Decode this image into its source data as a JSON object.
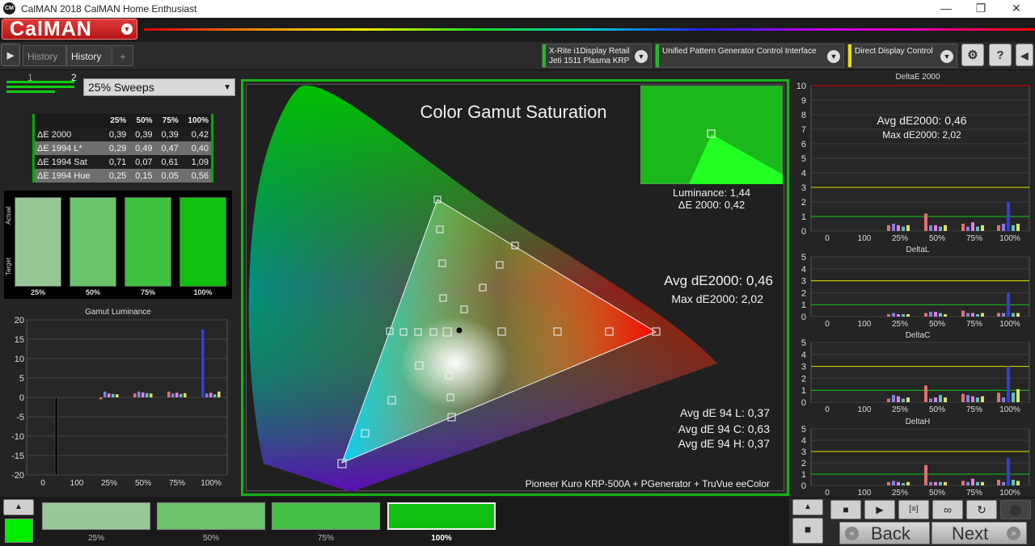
{
  "window": {
    "title": "CalMAN 2018 CalMAN Home Enthusiast",
    "icon_text": "CM",
    "controls": {
      "minimize": "—",
      "maximize": "❐",
      "close": "✕"
    }
  },
  "brand": {
    "logo_text": "CalMAN"
  },
  "tabs": {
    "play": "▶",
    "items": [
      {
        "label": "History 1"
      },
      {
        "label": "History 2"
      }
    ],
    "add": "+"
  },
  "devices": [
    {
      "line1": "X-Rite i1Display Retail",
      "line2": "Jeti 1511 Plasma KRP",
      "color": "#22bb22"
    },
    {
      "line1": "Unified Pattern Generator Control Interface",
      "line2": "",
      "color": "#22bb22"
    },
    {
      "line1": "Direct Display Control",
      "line2": "",
      "color": "#e8e000"
    }
  ],
  "toolbar_icons": {
    "settings": "⚙",
    "help": "?",
    "collapse": "◀"
  },
  "sweep_select": {
    "value": "25% Sweeps"
  },
  "summary_table": {
    "columns": [
      "",
      "25%",
      "50%",
      "75%",
      "100%"
    ],
    "rows": [
      {
        "label": "ΔE 2000",
        "values": [
          "0,39",
          "0,39",
          "0,39",
          "0,42"
        ]
      },
      {
        "label": "ΔE 1994 L*",
        "values": [
          "0,29",
          "0,49",
          "0,47",
          "0,40"
        ]
      },
      {
        "label": "ΔE 1994 Sat",
        "values": [
          "0,71",
          "0,07",
          "0,61",
          "1,09"
        ]
      },
      {
        "label": "ΔE 1994 Hue",
        "values": [
          "0,25",
          "0,15",
          "0,05",
          "0,56"
        ]
      }
    ]
  },
  "swatches": {
    "actual_label": "Actual",
    "target_label": "Target",
    "items": [
      {
        "label": "25%",
        "color": "#96c896"
      },
      {
        "label": "50%",
        "color": "#6ac46a"
      },
      {
        "label": "75%",
        "color": "#40c040"
      },
      {
        "label": "100%",
        "color": "#10c010"
      }
    ]
  },
  "gamut_luminance": {
    "title": "Gamut Luminance",
    "y_ticks": [
      "20",
      "15",
      "10",
      "5",
      "0",
      "-5",
      "-10",
      "-15",
      "-20"
    ],
    "x_ticks": [
      "0",
      "100",
      "25%",
      "50%",
      "75%",
      "100%"
    ],
    "ylim": [
      -20,
      20
    ],
    "black_bar": -20,
    "groups": [
      [
        -0.5,
        1.5,
        1.0,
        0.9,
        0.8
      ],
      [
        1.0,
        1.5,
        1.3,
        1.1,
        1.0
      ],
      [
        1.5,
        1.0,
        1.2,
        0.9,
        1.1
      ],
      [
        17.5,
        1.0,
        1.2,
        0.8,
        1.5
      ]
    ]
  },
  "gamut": {
    "title": "Color Gamut Saturation",
    "luminance": "Luminance: 1,44",
    "de2000_current": "ΔE 2000: 0,42",
    "avg": "Avg dE2000: 0,46",
    "max": "Max dE2000: 2,02",
    "avg_l": "Avg dE 94 L: 0,37",
    "avg_c": "Avg dE 94 C: 0,63",
    "avg_h": "Avg dE 94 H: 0,37",
    "footer": "Pioneer Kuro KRP-500A + PGenerator + TruVue eeColor"
  },
  "right_charts": [
    {
      "title": "DeltaE 2000",
      "ymax": 10,
      "y_ticks": [
        "10",
        "9",
        "8",
        "7",
        "6",
        "5",
        "4",
        "3",
        "2",
        "1",
        "0"
      ],
      "avg": "Avg dE2000: 0,46",
      "max": "Max dE2000: 2,02",
      "groups": [
        [
          0.4,
          0.5,
          0.4,
          0.3,
          0.4
        ],
        [
          1.2,
          0.4,
          0.4,
          0.3,
          0.4
        ],
        [
          0.5,
          0.3,
          0.6,
          0.3,
          0.4
        ],
        [
          0.4,
          0.5,
          2.0,
          0.4,
          0.5
        ]
      ]
    },
    {
      "title": "DeltaL",
      "ymax": 5,
      "y_ticks": [
        "5",
        "4",
        "3",
        "2",
        "1",
        "0"
      ],
      "groups": [
        [
          0.2,
          0.3,
          0.2,
          0.2,
          0.2
        ],
        [
          0.3,
          0.4,
          0.4,
          0.3,
          0.2
        ],
        [
          0.5,
          0.3,
          0.3,
          0.2,
          0.3
        ],
        [
          0.3,
          0.3,
          2.0,
          0.3,
          0.3
        ]
      ]
    },
    {
      "title": "DeltaC",
      "ymax": 5,
      "y_ticks": [
        "5",
        "4",
        "3",
        "2",
        "1",
        "0"
      ],
      "groups": [
        [
          0.3,
          0.6,
          0.5,
          0.3,
          0.4
        ],
        [
          1.4,
          0.3,
          0.4,
          0.6,
          0.4
        ],
        [
          0.7,
          0.6,
          0.5,
          0.4,
          0.5
        ],
        [
          0.8,
          0.4,
          3.0,
          0.8,
          1.1
        ]
      ]
    },
    {
      "title": "DeltaH",
      "ymax": 5,
      "y_ticks": [
        "5",
        "4",
        "3",
        "2",
        "1",
        "0"
      ],
      "groups": [
        [
          0.3,
          0.4,
          0.3,
          0.2,
          0.3
        ],
        [
          1.8,
          0.3,
          0.3,
          0.3,
          0.3
        ],
        [
          0.4,
          0.3,
          0.6,
          0.3,
          0.3
        ],
        [
          0.5,
          0.3,
          2.4,
          0.5,
          0.4
        ]
      ]
    }
  ],
  "right_x_ticks": [
    "0",
    "100",
    "25%",
    "50%",
    "75%",
    "100%"
  ],
  "bottom": {
    "up_arrow": "▲",
    "current_color": "#00ee00",
    "swatches": [
      {
        "label": "25%",
        "color": "#98c898"
      },
      {
        "label": "50%",
        "color": "#6cc46c"
      },
      {
        "label": "75%",
        "color": "#44c044"
      },
      {
        "label": "100%",
        "color": "#10c010"
      }
    ],
    "controls": [
      "■",
      "▶",
      "[≡]",
      "∞",
      "↻"
    ],
    "back": "Back",
    "next": "Next",
    "back_icon": "«",
    "next_icon": "»"
  }
}
